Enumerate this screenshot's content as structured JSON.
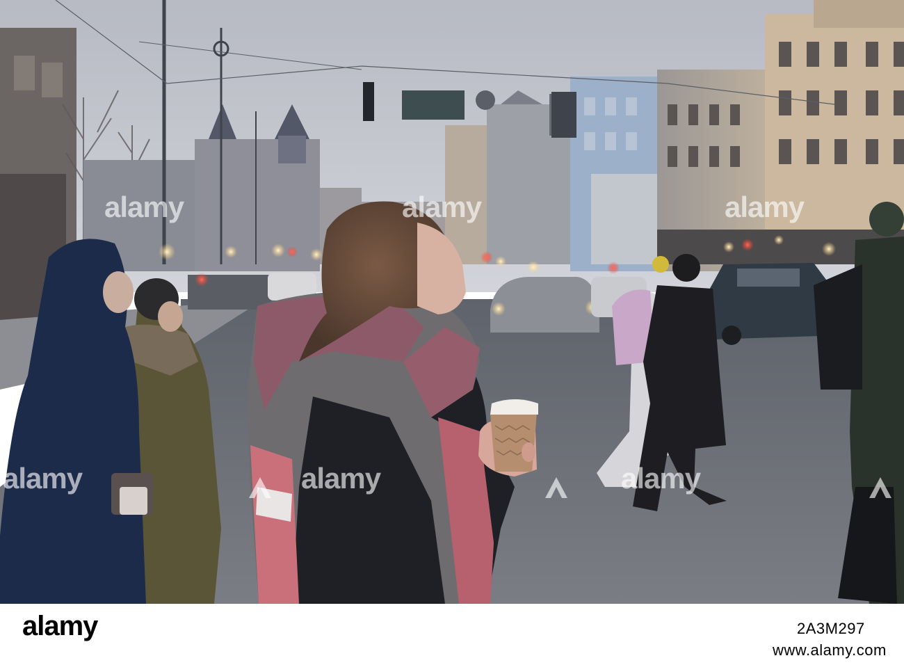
{
  "watermark": {
    "brand": "alamy"
  },
  "footer": {
    "logo_text": "alamy",
    "image_id": "2A3M297",
    "url": "www.alamy.com"
  },
  "scene": {
    "subject": "woman-with-coffee-cup",
    "colors": {
      "sky": "#c7cad1",
      "road": "#6f727a",
      "scarf_pink": "#c9707a",
      "scarf_gray": "#6f6c70",
      "cup": "#b58d6f",
      "cup_lid": "#f1ede9",
      "coat": "#1e2026",
      "olive_jacket": "#5a5536",
      "navy_coat": "#1d2b4a"
    }
  }
}
